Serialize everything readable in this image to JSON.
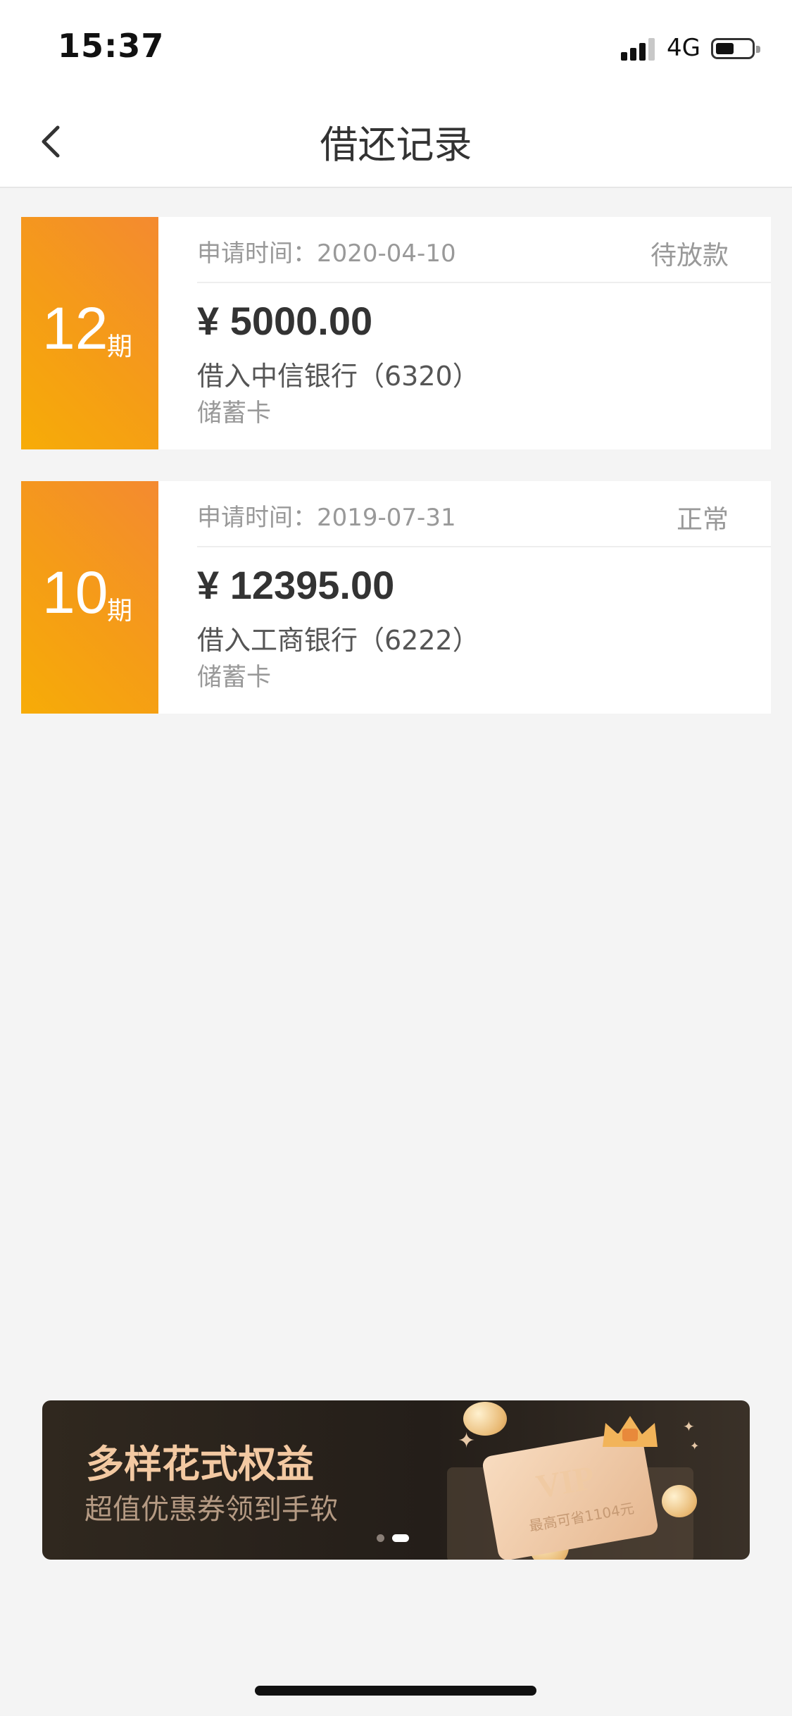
{
  "status_bar": {
    "time": "15:37",
    "network": "4G"
  },
  "nav": {
    "title": "借还记录"
  },
  "records": [
    {
      "periods": "12",
      "period_unit": "期",
      "apply_time": "申请时间：2020-04-10",
      "status": "待放款",
      "amount": "¥ 5000.00",
      "bank": "借入中信银行（6320）",
      "card_type": "储蓄卡"
    },
    {
      "periods": "10",
      "period_unit": "期",
      "apply_time": "申请时间：2019-07-31",
      "status": "正常",
      "amount": "¥ 12395.00",
      "bank": "借入工商银行（6222）",
      "card_type": "储蓄卡"
    }
  ],
  "banner": {
    "title": "多样花式权益",
    "subtitle": "超值优惠券领到手软",
    "vip_label": "VIP",
    "vip_note": "最高可省1104元",
    "page_index": 2,
    "page_count": 2
  },
  "colors": {
    "badge_gradient_start": "#f7ac07",
    "badge_gradient_end": "#f48a30",
    "banner_title": "#f3c9a2",
    "background": "#f4f4f4"
  }
}
